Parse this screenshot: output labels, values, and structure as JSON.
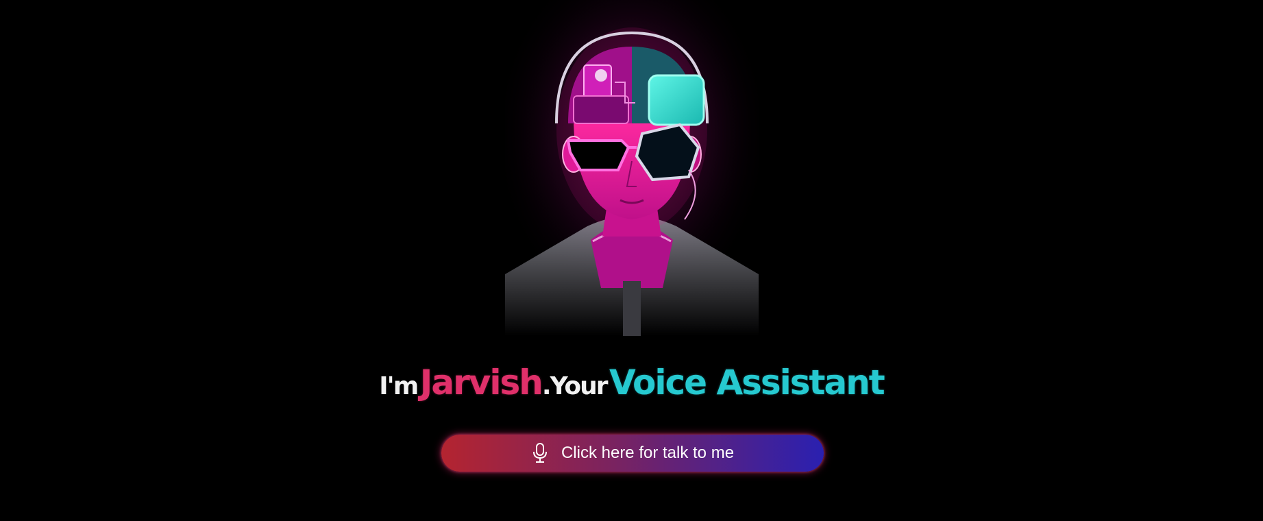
{
  "hero": {
    "image_alt": "neon-cyborg-avatar"
  },
  "headline": {
    "prefix": "I'm",
    "name": "Jarvish",
    "connector": ".Your",
    "role": "Voice Assistant"
  },
  "talk_button": {
    "icon": "microphone-icon",
    "label": "Click here for talk to me"
  },
  "colors": {
    "background": "#000000",
    "name_accent": "#e0306a",
    "role_accent": "#26c9d0",
    "button_gradient_start": "#b42430",
    "button_gradient_end": "#2a20b0",
    "neon_pink": "#ff1aa8",
    "neon_cyan": "#30e0d0"
  }
}
